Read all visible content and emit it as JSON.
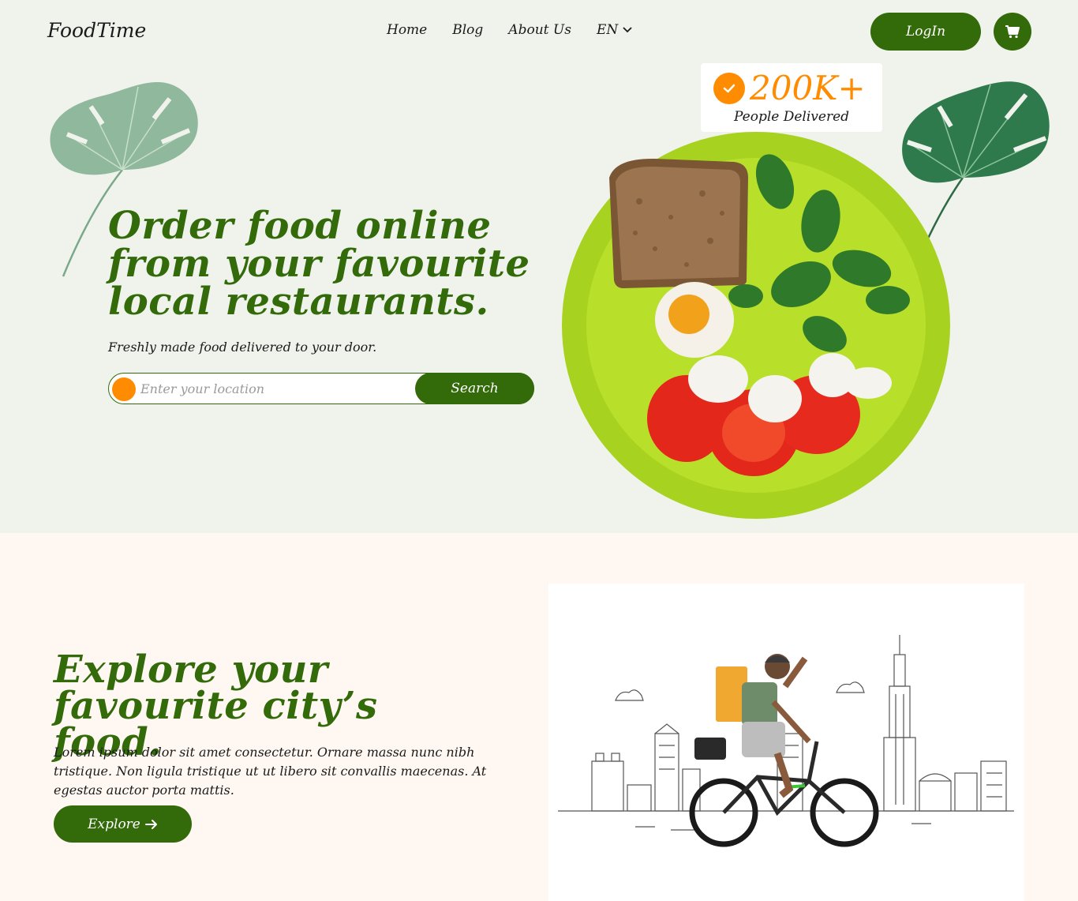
{
  "header": {
    "logo": "FoodTime",
    "nav": [
      {
        "label": "Home"
      },
      {
        "label": "Blog"
      },
      {
        "label": "About Us"
      },
      {
        "label": "EN"
      }
    ],
    "login_label": "LogIn",
    "cart_icon": "cart-icon"
  },
  "hero": {
    "title_line1": "Order food online",
    "title_line2": "from your favourite",
    "title_line3": "local restaurants.",
    "subtitle": "Freshly made food delivered to your door.",
    "search_placeholder": "Enter your location",
    "search_label": "Search",
    "badge_value": "200K+",
    "badge_label": "People Delivered"
  },
  "explore": {
    "title_line1": "Explore your",
    "title_line2": "favourite city’s food.",
    "text": "Lorem ipsum dolor sit amet consectetur. Ornare massa nunc nibh tristique. Non ligula tristique ut ut libero sit convallis maecenas. At egestas auctor porta mattis.",
    "button_label": "Explore"
  },
  "colors": {
    "primary_green": "#336a0a",
    "accent_orange": "#ff8c00",
    "hero_bg": "#f0f3ec",
    "section_bg": "#fff8f2"
  }
}
